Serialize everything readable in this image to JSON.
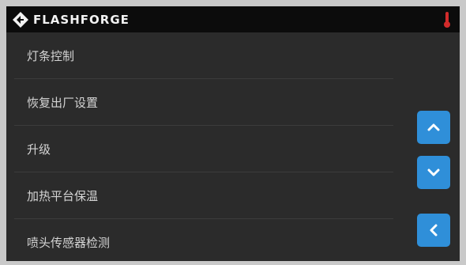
{
  "header": {
    "brand": "FLASHFORGE",
    "logo_icon": "flashforge-logo-icon",
    "status_icon": "thermometer-icon",
    "status_color": "#d22b2b"
  },
  "menu": {
    "items": [
      {
        "label": "灯条控制"
      },
      {
        "label": "恢复出厂设置"
      },
      {
        "label": "升级"
      },
      {
        "label": "加热平台保温"
      },
      {
        "label": "喷头传感器检测"
      }
    ]
  },
  "controls": {
    "scroll_up_icon": "chevron-up-icon",
    "scroll_down_icon": "chevron-down-icon",
    "back_icon": "chevron-left-icon",
    "accent": "#2f8fd9"
  }
}
